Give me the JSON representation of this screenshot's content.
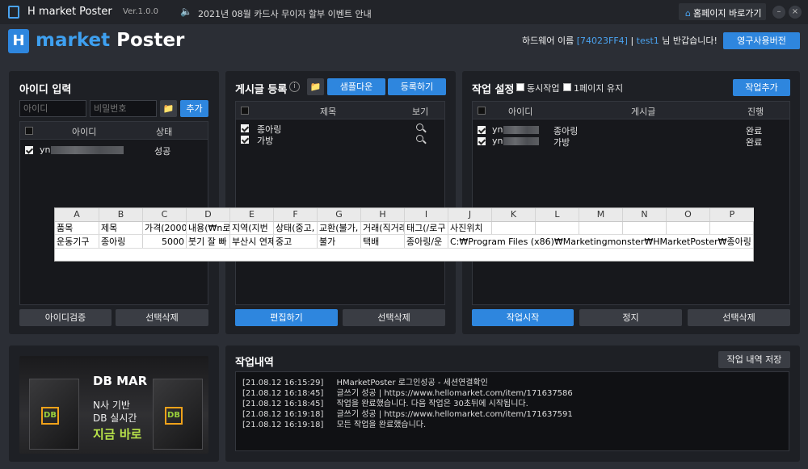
{
  "titlebar": {
    "app_name": "H market Poster",
    "version": "Ver.1.0.0",
    "notice": "2021년 08월 카드사 무이자 할부 이벤트 안내",
    "home_button": "홈페이지 바로가기",
    "minimize": "–",
    "close": "×"
  },
  "header": {
    "logo_letter": "H",
    "title_part1": "market",
    "title_part2": " Poster",
    "hardware_label": "하드웨어 이름",
    "hardware_id": "[74023FF4]",
    "separator": "|",
    "user": "test1",
    "greeting": "님 반갑습니다!",
    "license_button": "영구사용버전"
  },
  "id_panel": {
    "title": "아이디 입력",
    "id_placeholder": "아이디",
    "pw_placeholder": "비밀번호",
    "add_button": "추가",
    "columns": [
      "아이디",
      "상태"
    ],
    "rows": [
      {
        "id": "yn",
        "status": "성공"
      }
    ],
    "verify_button": "아이디검증",
    "delete_button": "선택삭제"
  },
  "post_panel": {
    "title": "게시글 등록",
    "info_icon": "i",
    "sample_button": "샘플다운",
    "register_button": "등록하기",
    "columns": [
      "제목",
      "보기"
    ],
    "rows": [
      {
        "title": "종아링"
      },
      {
        "title": "가방"
      }
    ],
    "edit_button": "편집하기",
    "delete_button": "선택삭제"
  },
  "job_panel": {
    "title": "작업 설정",
    "option_simultaneous": "동시작업",
    "option_keep_page": "1페이지 유지",
    "add_button": "작업추가",
    "columns": [
      "아이디",
      "게시글",
      "진행"
    ],
    "rows": [
      {
        "id": "yn",
        "post": "종아링",
        "progress": "완료"
      },
      {
        "id": "yn",
        "post": "가방",
        "progress": "완료"
      }
    ],
    "start_button": "작업시작",
    "stop_button": "정지",
    "delete_button": "선택삭제"
  },
  "spreadsheet": {
    "columns": [
      "A",
      "B",
      "C",
      "D",
      "E",
      "F",
      "G",
      "H",
      "I",
      "J",
      "K",
      "L",
      "M",
      "N",
      "O",
      "P"
    ],
    "row1": [
      "품목",
      "제목",
      "가격(2000",
      "내용(₩n로",
      "지역(지번",
      "상태(중고,",
      "교환(불가,",
      "거래(직거래",
      "태그(/로구",
      "사진위치"
    ],
    "row2": [
      "운동기구",
      "종아링",
      "5000",
      "붓기 잘 빠",
      "부산시 연제",
      "중고",
      "불가",
      "택배",
      "종아링/운",
      "C:₩Program Files (x86)₩Marketingmonster₩HMarketPoster₩종아링"
    ]
  },
  "banner": {
    "box_label": "DB",
    "line1": "DB MAR",
    "line2": "N사 기반",
    "line3": "DB 실시간",
    "line4": "지금 바로"
  },
  "log_panel": {
    "title": "작업내역",
    "save_button": "작업 내역 저장",
    "lines": [
      {
        "ts": "[21.08.12 16:15:29]",
        "msg": "HMarketPoster 로그인성공 - 세션연결확인"
      },
      {
        "ts": "[21.08.12 16:18:45]",
        "msg": "글쓰기 성공 | https://www.hellomarket.com/item/171637586"
      },
      {
        "ts": "[21.08.12 16:18:45]",
        "msg": "작업을 완료했습니다. 다음 작업은 30초뒤에 시작됩니다."
      },
      {
        "ts": "[21.08.12 16:19:18]",
        "msg": "글쓰기 성공 | https://www.hellomarket.com/item/171637591"
      },
      {
        "ts": "[21.08.12 16:19:18]",
        "msg": "모든 작업을 완료했습니다."
      }
    ]
  },
  "colors": {
    "accent": "#2e86de",
    "background": "#2b2e35",
    "panel": "#1e2025",
    "banner_green": "#b8e34a"
  }
}
